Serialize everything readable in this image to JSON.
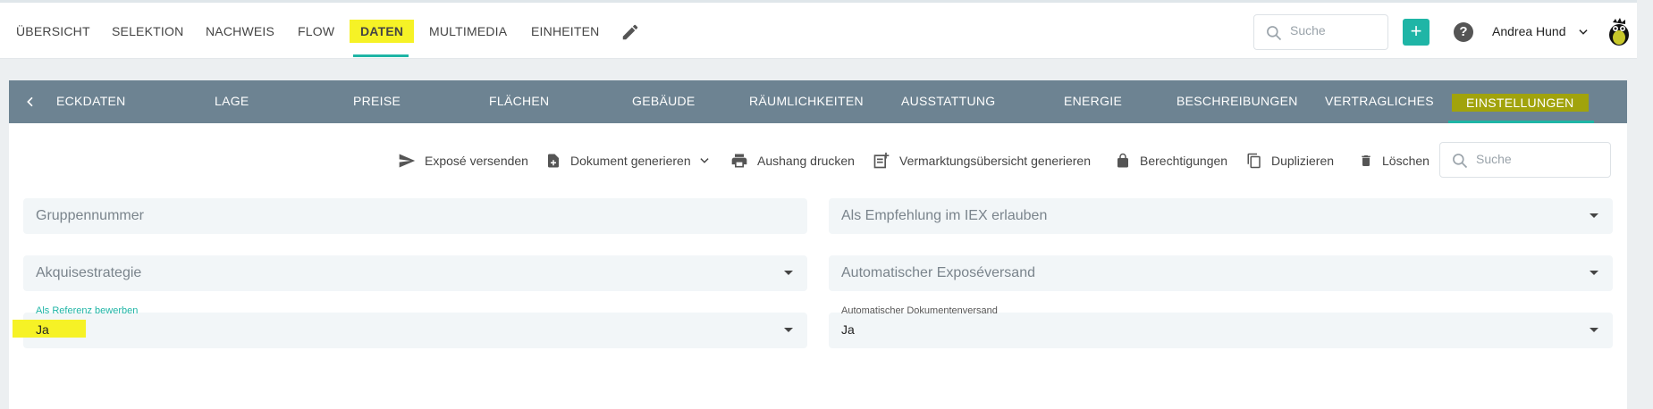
{
  "topnav": {
    "items": [
      "ÜBERSICHT",
      "SELEKTION",
      "NACHWEIS",
      "FLOW",
      "DATEN",
      "MULTIMEDIA",
      "EINHEITEN"
    ],
    "active": "DATEN",
    "search_placeholder": "Suche",
    "add_label": "+",
    "help_label": "?",
    "user_name": "Andrea Hund"
  },
  "subnav": {
    "items": [
      "ECKDATEN",
      "LAGE",
      "PREISE",
      "FLÄCHEN",
      "GEBÄUDE",
      "RÄUMLICHKEITEN",
      "AUSSTATTUNG",
      "ENERGIE",
      "BESCHREIBUNGEN",
      "VERTRAGLICHES",
      "EINSTELLUNGEN"
    ],
    "active": "EINSTELLUNGEN"
  },
  "toolbar": {
    "expose_versenden": "Exposé versenden",
    "dokument_generieren": "Dokument generieren",
    "aushang_drucken": "Aushang drucken",
    "vermarktung": "Vermarktungsübersicht generieren",
    "berechtigungen": "Berechtigungen",
    "duplizieren": "Duplizieren",
    "loeschen": "Löschen",
    "search_placeholder": "Suche"
  },
  "form": {
    "gruppennummer": "Gruppennummer",
    "empfehlung": "Als Empfehlung im IEX erlauben",
    "akquise": "Akquisestrategie",
    "exposeversand": "Automatischer Exposéversand",
    "referenz_label": "Als Referenz bewerben",
    "referenz_value": "Ja",
    "dokumentenversand_label": "Automatischer Dokumentenversand",
    "dokumentenversand_value": "Ja"
  },
  "colors": {
    "accent": "#1fb5a6",
    "subnav_bg": "#6d8392",
    "highlight": "#f6f226"
  }
}
